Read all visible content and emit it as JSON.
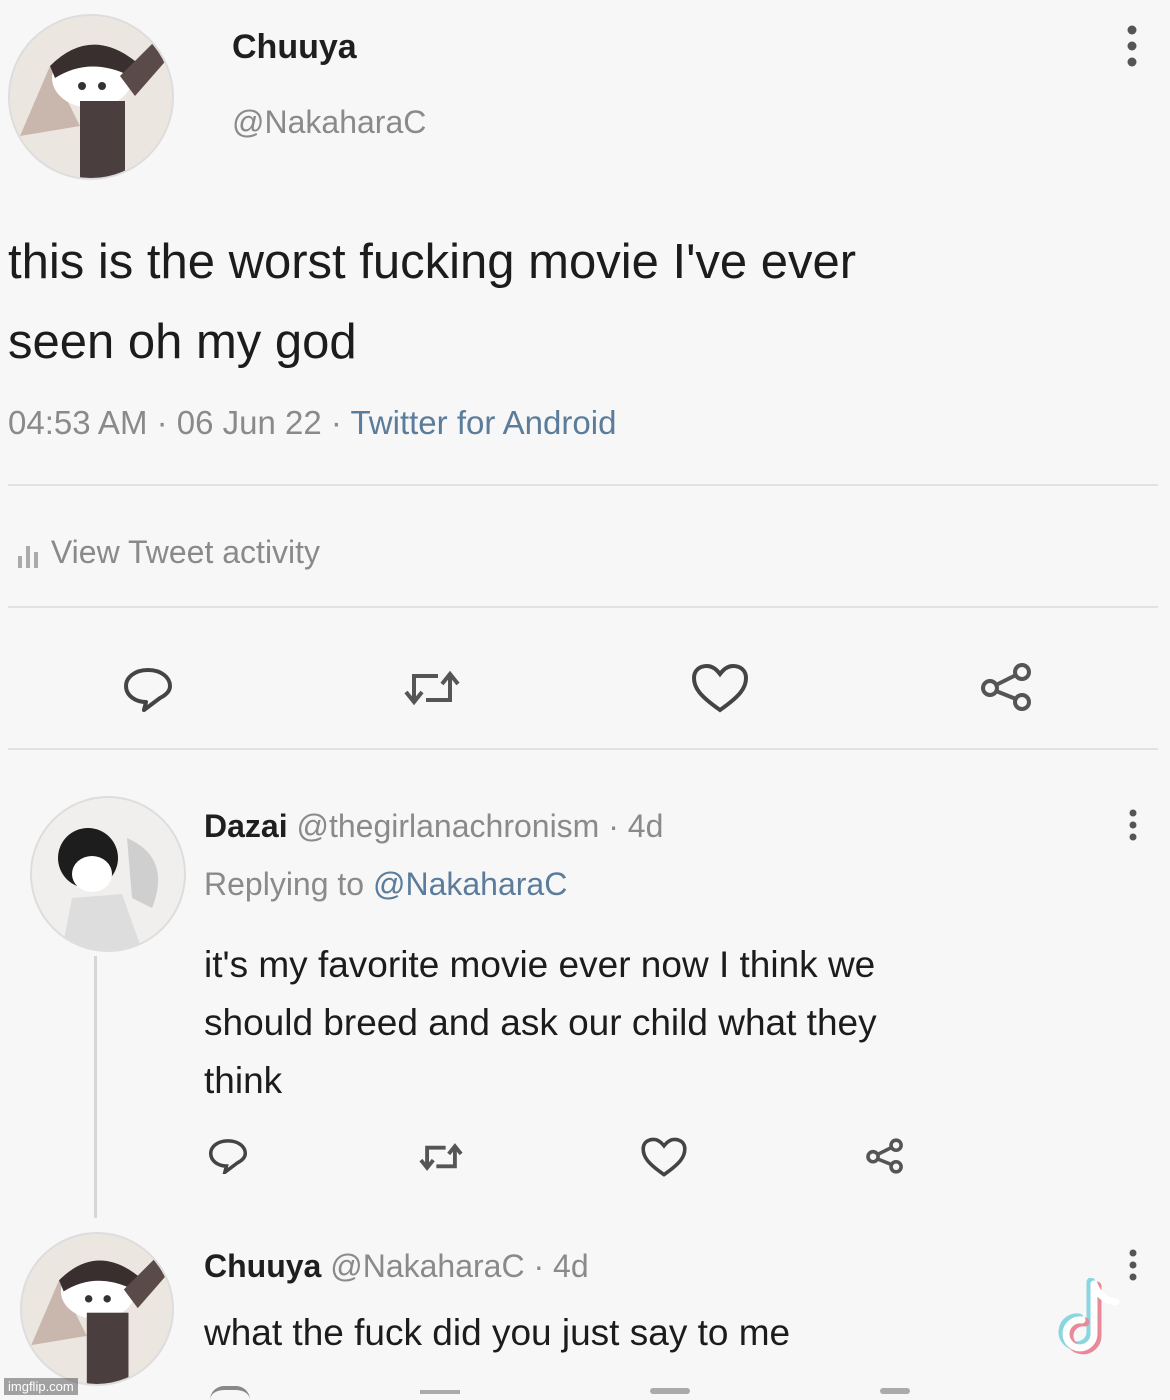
{
  "main_tweet": {
    "display_name": "Chuuya",
    "handle": "@NakaharaC",
    "text_line1": "this is the worst fucking movie I've ever",
    "text_line2": "seen oh my god",
    "time": "04:53 AM",
    "date": "· 06 Jun 22 ·",
    "source": "Twitter for Android",
    "activity_label": "View Tweet activity",
    "icons": [
      "more-vertical-icon",
      "reply-icon",
      "retweet-icon",
      "like-icon",
      "share-icon",
      "bar-chart-icon"
    ]
  },
  "reply_1": {
    "display_name": "Dazai",
    "handle_meta": "@thegirlanachronism · 4d",
    "replying_prefix": "Replying to",
    "replying_handle": "@NakaharaC",
    "text_line1": "it's my favorite movie ever now I think we",
    "text_line2": "should breed and ask our child what they",
    "text_line3": "think"
  },
  "reply_2": {
    "display_name": "Chuuya",
    "handle_meta": "@NakaharaC · 4d",
    "text": "what the fuck did you just say to me"
  },
  "watermark": "imgflip.com",
  "overlay_logo": "tiktok-logo"
}
